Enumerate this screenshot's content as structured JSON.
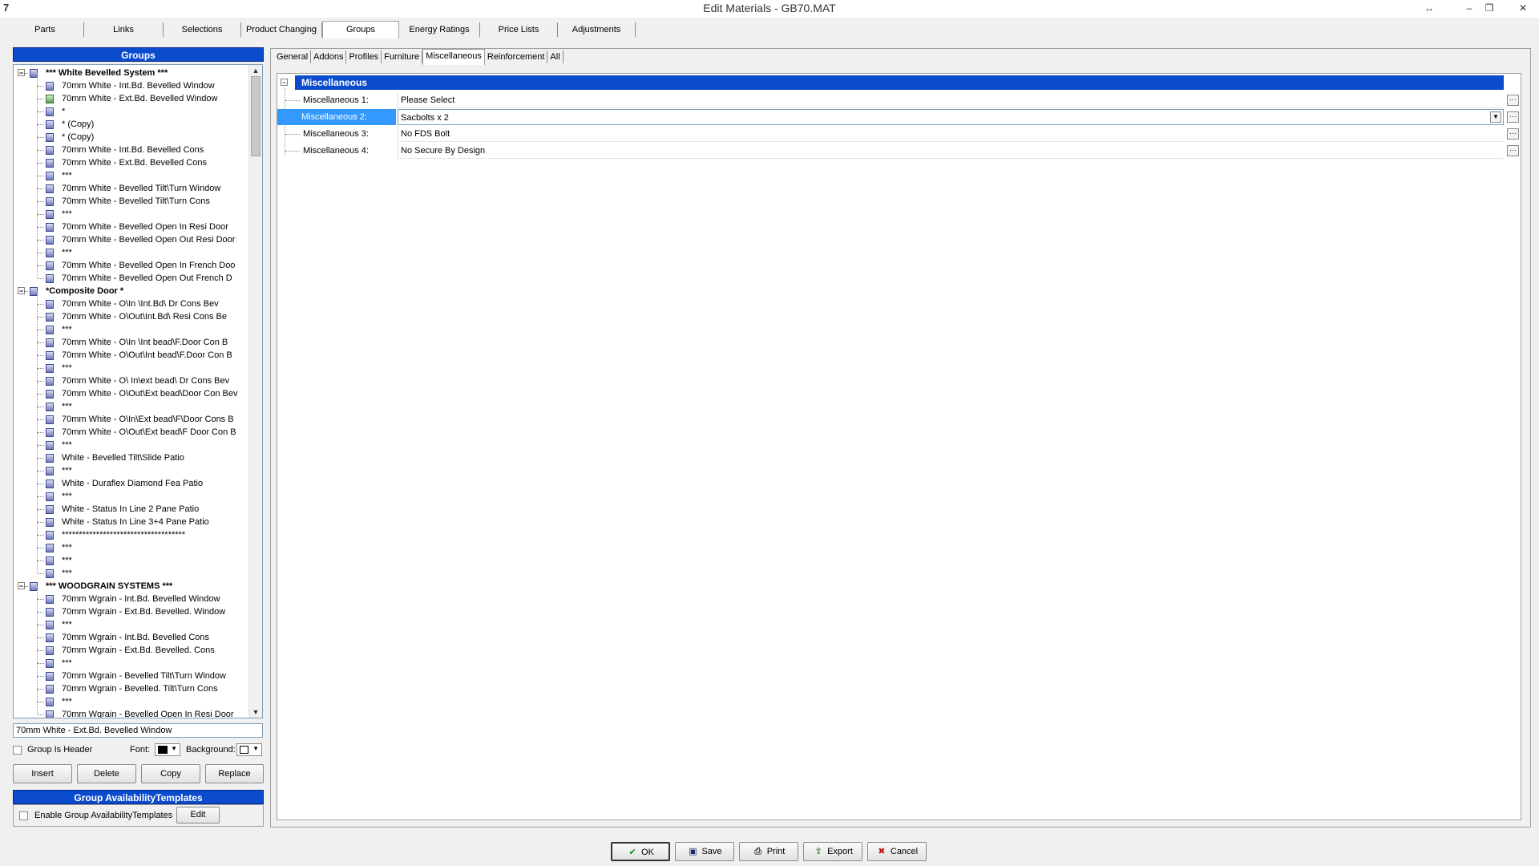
{
  "window": {
    "title": "Edit Materials - GB70.MAT"
  },
  "main_tabs": [
    {
      "label": "Parts"
    },
    {
      "label": "Links"
    },
    {
      "label": "Selections"
    },
    {
      "label": "Product Changing"
    },
    {
      "label": "Groups"
    },
    {
      "label": "Energy Ratings"
    },
    {
      "label": "Price Lists"
    },
    {
      "label": "Adjustments"
    }
  ],
  "groups_panel": {
    "title": "Groups",
    "tree": [
      {
        "level": 0,
        "text": "*** White Bevelled System ***"
      },
      {
        "level": 1,
        "text": "70mm White - Int.Bd. Bevelled Window"
      },
      {
        "level": 1,
        "text": "70mm White - Ext.Bd. Bevelled Window",
        "icon": "green"
      },
      {
        "level": 1,
        "text": "*"
      },
      {
        "level": 1,
        "text": "* (Copy)"
      },
      {
        "level": 1,
        "text": "* (Copy)"
      },
      {
        "level": 1,
        "text": "70mm White - Int.Bd. Bevelled Cons"
      },
      {
        "level": 1,
        "text": "70mm White - Ext.Bd. Bevelled Cons"
      },
      {
        "level": 1,
        "text": "***"
      },
      {
        "level": 1,
        "text": "70mm White - Bevelled Tilt\\Turn Window"
      },
      {
        "level": 1,
        "text": "70mm White - Bevelled Tilt\\Turn Cons"
      },
      {
        "level": 1,
        "text": "***"
      },
      {
        "level": 1,
        "text": "70mm White - Bevelled Open In Resi Door"
      },
      {
        "level": 1,
        "text": "70mm White - Bevelled Open Out Resi Door"
      },
      {
        "level": 1,
        "text": "***"
      },
      {
        "level": 1,
        "text": "70mm White - Bevelled Open In French Doo"
      },
      {
        "level": 1,
        "text": "70mm White - Bevelled  Open Out French D"
      },
      {
        "level": 0,
        "text": "*Composite Door *"
      },
      {
        "level": 1,
        "text": "70mm White - O\\In \\Int.Bd\\ Dr Cons Bev"
      },
      {
        "level": 1,
        "text": "70mm White - O\\Out\\Int.Bd\\ Resi  Cons Be"
      },
      {
        "level": 1,
        "text": "***"
      },
      {
        "level": 1,
        "text": "70mm White - O\\In \\Int bead\\F.Door Con B"
      },
      {
        "level": 1,
        "text": "70mm White - O\\Out\\Int bead\\F.Door Con B"
      },
      {
        "level": 1,
        "text": "***"
      },
      {
        "level": 1,
        "text": "70mm White - O\\ In\\ext bead\\ Dr Cons Bev"
      },
      {
        "level": 1,
        "text": "70mm White - O\\Out\\Ext bead\\Door Con Bev"
      },
      {
        "level": 1,
        "text": "***"
      },
      {
        "level": 1,
        "text": "70mm White - O\\In\\Ext bead\\F\\Door Cons B"
      },
      {
        "level": 1,
        "text": "70mm White - O\\Out\\Ext bead\\F Door Con B"
      },
      {
        "level": 1,
        "text": "***"
      },
      {
        "level": 1,
        "text": "White - Bevelled Tilt\\Slide Patio"
      },
      {
        "level": 1,
        "text": "***"
      },
      {
        "level": 1,
        "text": "White - Duraflex Diamond Fea Patio"
      },
      {
        "level": 1,
        "text": "***"
      },
      {
        "level": 1,
        "text": "White - Status In Line 2 Pane Patio"
      },
      {
        "level": 1,
        "text": "White - Status In Line 3+4 Pane Patio"
      },
      {
        "level": 1,
        "text": "************************************"
      },
      {
        "level": 1,
        "text": "***"
      },
      {
        "level": 1,
        "text": "***"
      },
      {
        "level": 1,
        "text": "***"
      },
      {
        "level": 0,
        "text": "*** WOODGRAIN SYSTEMS ***"
      },
      {
        "level": 1,
        "text": "70mm Wgrain - Int.Bd. Bevelled Window"
      },
      {
        "level": 1,
        "text": "70mm Wgrain - Ext.Bd. Bevelled. Window"
      },
      {
        "level": 1,
        "text": "***"
      },
      {
        "level": 1,
        "text": "70mm Wgrain - Int.Bd. Bevelled Cons"
      },
      {
        "level": 1,
        "text": "70mm Wgrain - Ext.Bd. Bevelled. Cons"
      },
      {
        "level": 1,
        "text": "***"
      },
      {
        "level": 1,
        "text": "70mm Wgrain - Bevelled Tilt\\Turn Window"
      },
      {
        "level": 1,
        "text": "70mm Wgrain - Bevelled. Tilt\\Turn Cons"
      },
      {
        "level": 1,
        "text": "***"
      },
      {
        "level": 1,
        "text": "70mm Wgrain - Bevelled Open In Resi Door"
      }
    ],
    "name_value": "70mm White - Ext.Bd. Bevelled Window",
    "group_is_header_label": "Group Is Header",
    "font_label": "Font:",
    "background_label": "Background:",
    "buttons": {
      "insert": "Insert",
      "delete": "Delete",
      "copy": "Copy",
      "replace": "Replace"
    }
  },
  "availability_panel": {
    "title": "Group AvailabilityTemplates",
    "enable_label": "Enable Group AvailabilityTemplates",
    "edit_label": "Edit"
  },
  "sub_tabs": [
    {
      "label": "General"
    },
    {
      "label": "Addons"
    },
    {
      "label": "Profiles"
    },
    {
      "label": "Furniture"
    },
    {
      "label": "Miscellaneous"
    },
    {
      "label": "Reinforcement"
    },
    {
      "label": "All"
    }
  ],
  "grid": {
    "section_title": "Miscellaneous",
    "rows": [
      {
        "label": "Miscellaneous 1:",
        "value": "Please Select"
      },
      {
        "label": "Miscellaneous 2:",
        "value": "Sacbolts x 2"
      },
      {
        "label": "Miscellaneous 3:",
        "value": "No FDS Bolt"
      },
      {
        "label": "Miscellaneous 4:",
        "value": "No Secure By Design"
      }
    ]
  },
  "footer_buttons": {
    "ok": "OK",
    "save": "Save",
    "print": "Print",
    "export": "Export",
    "cancel": "Cancel"
  },
  "colors": {
    "header_blue": "#0b4ccf",
    "selection_blue": "#3399ff"
  }
}
